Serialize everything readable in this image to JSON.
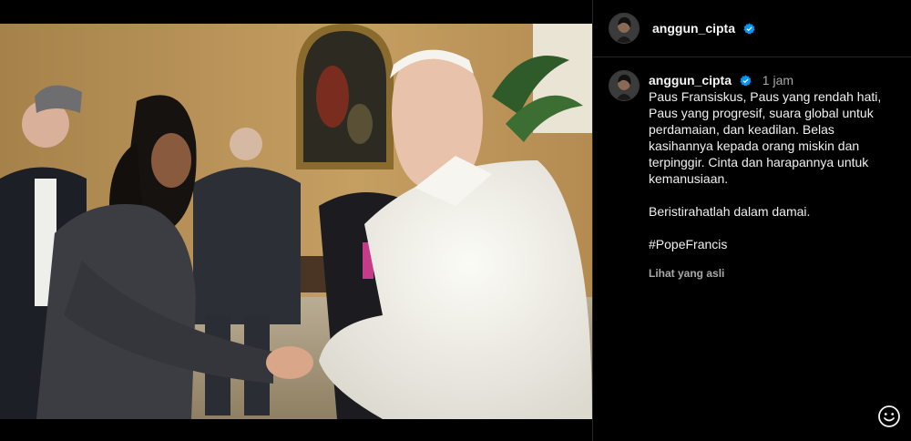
{
  "post": {
    "author": {
      "username": "anggun_cipta",
      "verified": true
    },
    "caption": {
      "username": "anggun_cipta",
      "time_ago": "1 jam",
      "paragraph_1": "Paus Fransiskus, Paus yang rendah hati, Paus yang progresif, suara global untuk perdamaian, dan keadilan. Belas kasihannya kepada orang miskin dan terpinggir. Cinta dan harapannya untuk kemanusiaan.",
      "paragraph_2": "Beristirahatlah dalam damai.",
      "hashtag": "#PopeFrancis",
      "see_original": "Lihat yang asli"
    },
    "icons": {
      "verified": "verified-badge-icon",
      "emoji": "emoji-smiley-icon"
    }
  },
  "colors": {
    "background": "#000000",
    "divider": "#262626",
    "verified_blue": "#0095f6",
    "muted_text": "#a8a8a8"
  }
}
